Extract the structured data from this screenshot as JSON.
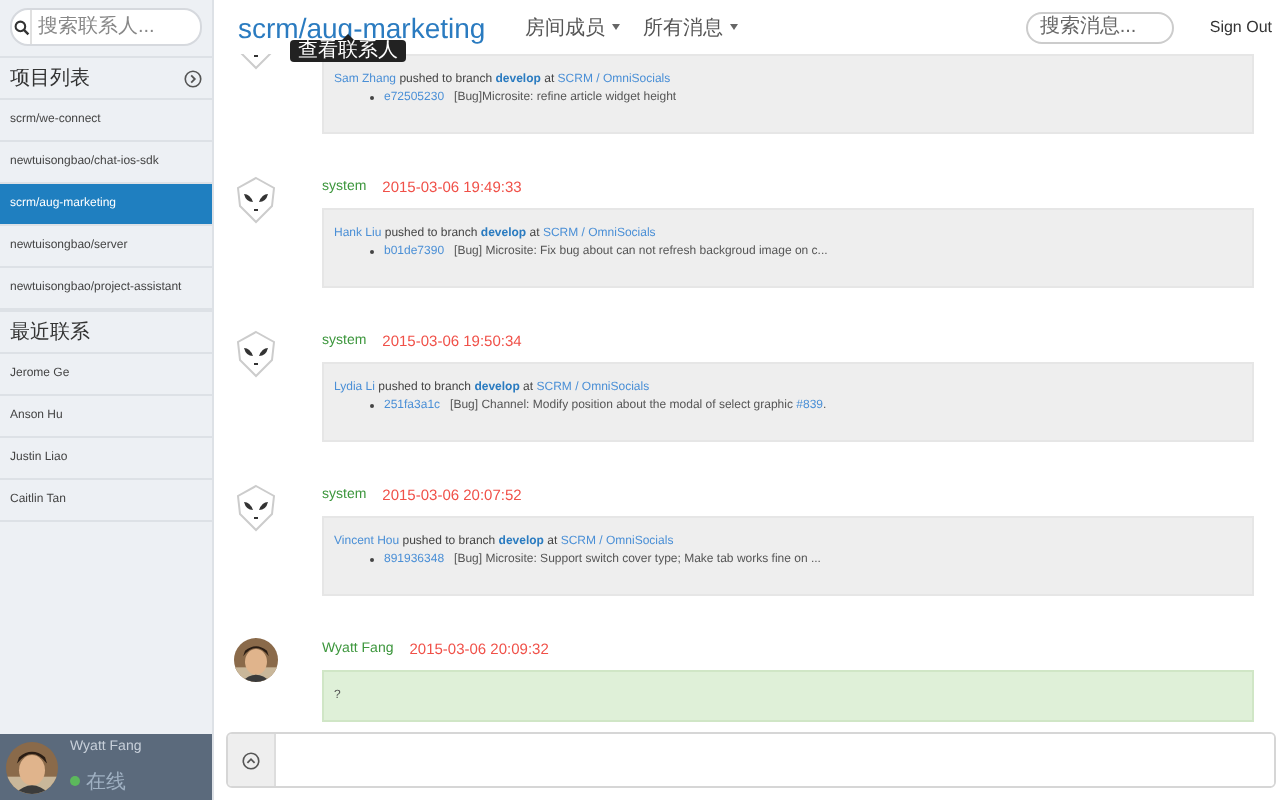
{
  "sidebar": {
    "search": {
      "placeholder": "搜索联系人..."
    },
    "projects": {
      "title": "项目列表",
      "items": [
        {
          "label": "scrm/we-connect",
          "selected": false
        },
        {
          "label": "newtuisongbao/chat-ios-sdk",
          "selected": false
        },
        {
          "label": "scrm/aug-marketing",
          "selected": true
        },
        {
          "label": "newtuisongbao/server",
          "selected": false
        },
        {
          "label": "newtuisongbao/project-assistant",
          "selected": false
        }
      ]
    },
    "recent": {
      "title": "最近联系",
      "items": [
        {
          "label": "Jerome Ge"
        },
        {
          "label": "Anson Hu"
        },
        {
          "label": "Justin Liao"
        },
        {
          "label": "Caitlin Tan"
        }
      ]
    },
    "user": {
      "name": "Wyatt Fang",
      "status": "在线",
      "online": true
    }
  },
  "header": {
    "title": "scrm/aug-marketing",
    "menus": [
      "房间成员",
      "所有消息"
    ],
    "search": {
      "placeholder": "搜索消息..."
    },
    "sign_out": "Sign Out"
  },
  "tooltip": "查看联系人",
  "messages": [
    {
      "avatar": {
        "kind": "alien"
      },
      "kind": "push",
      "push": {
        "user": "Sam Zhang",
        "action": "pushed to branch",
        "branch": "develop",
        "at": "at",
        "repo": "SCRM / OmniSocials"
      },
      "commit": {
        "hash": "e72505230",
        "message": "[Bug]Microsite: refine article widget height"
      }
    },
    {
      "avatar": {
        "kind": "alien"
      },
      "author": "system",
      "time": "2015-03-06 19:49:33",
      "kind": "push",
      "push": {
        "user": "Hank Liu",
        "action": "pushed to branch",
        "branch": "develop",
        "at": "at",
        "repo": "SCRM / OmniSocials"
      },
      "commit": {
        "hash": "b01de7390",
        "message": "[Bug] Microsite: Fix bug about can not refresh backgroud image on c..."
      }
    },
    {
      "avatar": {
        "kind": "alien"
      },
      "author": "system",
      "time": "2015-03-06 19:50:34",
      "kind": "push",
      "push": {
        "user": "Lydia Li",
        "action": "pushed to branch",
        "branch": "develop",
        "at": "at",
        "repo": "SCRM / OmniSocials"
      },
      "commit": {
        "hash": "251fa3a1c",
        "message": "[Bug] Channel: Modify position about the modal of select graphic ",
        "issue": "#839",
        "suffix": "."
      }
    },
    {
      "avatar": {
        "kind": "alien"
      },
      "author": "system",
      "time": "2015-03-06 20:07:52",
      "kind": "push",
      "push": {
        "user": "Vincent Hou",
        "action": "pushed to branch",
        "branch": "develop",
        "at": "at",
        "repo": "SCRM / OmniSocials"
      },
      "commit": {
        "hash": "891936348",
        "message": "[Bug] Microsite: Support switch cover type; Make tab works fine on ..."
      }
    },
    {
      "author": "Wyatt Fang",
      "time": "2015-03-06 20:09:32",
      "kind": "text",
      "text": "?"
    }
  ]
}
